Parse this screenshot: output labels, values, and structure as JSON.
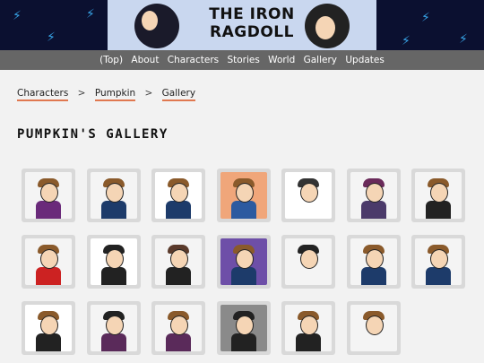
{
  "header": {
    "title_line1": "THE IRON",
    "title_line2": "RAGDOLL"
  },
  "nav": {
    "items": [
      "(Top)",
      "About",
      "Characters",
      "Stories",
      "World",
      "Gallery",
      "Updates"
    ]
  },
  "breadcrumb": {
    "items": [
      "Characters",
      "Pumpkin",
      "Gallery"
    ],
    "separator": ">"
  },
  "page": {
    "title": "PUMPKIN'S GALLERY"
  },
  "colors": {
    "nav_bg": "#666666",
    "accent": "#e07850",
    "banner_bg": "#0b1030",
    "thumb_bg": "#d9d9d9"
  },
  "gallery": {
    "thumbnails": [
      {
        "name": "gallery-thumb-1",
        "bg": "#f4f4f4",
        "body": "#6a2a7a",
        "hair": "#8a5a2b"
      },
      {
        "name": "gallery-thumb-2",
        "bg": "#f4f4f4",
        "body": "#1d3b6a",
        "hair": "#8a5a2b"
      },
      {
        "name": "gallery-thumb-3",
        "bg": "#ffffff",
        "body": "#1d3b6a",
        "hair": "#8a5a2b"
      },
      {
        "name": "gallery-thumb-4",
        "bg": "#f0a67a",
        "body": "#2c5aa0",
        "hair": "#8a5a2b"
      },
      {
        "name": "gallery-thumb-5",
        "bg": "#ffffff",
        "body": "#ffffff",
        "hair": "#333333"
      },
      {
        "name": "gallery-thumb-6",
        "bg": "#f4f4f4",
        "body": "#4b3a6a",
        "hair": "#6a2a5a"
      },
      {
        "name": "gallery-thumb-7",
        "bg": "#f4f4f4",
        "body": "#222222",
        "hair": "#8a5a2b"
      },
      {
        "name": "gallery-thumb-8",
        "bg": "#f4f4f4",
        "body": "#cc2222",
        "hair": "#8a5a2b"
      },
      {
        "name": "gallery-thumb-9",
        "bg": "#ffffff",
        "body": "#222222",
        "hair": "#222222"
      },
      {
        "name": "gallery-thumb-10",
        "bg": "#f4f4f4",
        "body": "#222222",
        "hair": "#5a3a2b"
      },
      {
        "name": "gallery-thumb-11",
        "bg": "#6e4fa8",
        "body": "#1d3b6a",
        "hair": "#8a5a2b"
      },
      {
        "name": "gallery-thumb-12",
        "bg": "#f4f4f4",
        "body": "#f4f4f4",
        "hair": "#222222"
      },
      {
        "name": "gallery-thumb-13",
        "bg": "#f4f4f4",
        "body": "#1d3b6a",
        "hair": "#8a5a2b"
      },
      {
        "name": "gallery-thumb-14",
        "bg": "#f4f4f4",
        "body": "#1d3b6a",
        "hair": "#8a5a2b"
      },
      {
        "name": "gallery-thumb-15",
        "bg": "#ffffff",
        "body": "#222222",
        "hair": "#8a5a2b"
      },
      {
        "name": "gallery-thumb-16",
        "bg": "#f4f4f4",
        "body": "#5a2a5a",
        "hair": "#222222"
      },
      {
        "name": "gallery-thumb-17",
        "bg": "#f4f4f4",
        "body": "#5a2a5a",
        "hair": "#8a5a2b"
      },
      {
        "name": "gallery-thumb-18",
        "bg": "#8a8a8a",
        "body": "#222222",
        "hair": "#222222"
      },
      {
        "name": "gallery-thumb-19",
        "bg": "#f4f4f4",
        "body": "#222222",
        "hair": "#8a5a2b"
      },
      {
        "name": "gallery-thumb-20",
        "bg": "#f4f4f4",
        "body": "#f4f4f4",
        "hair": "#8a5a2b"
      }
    ]
  }
}
